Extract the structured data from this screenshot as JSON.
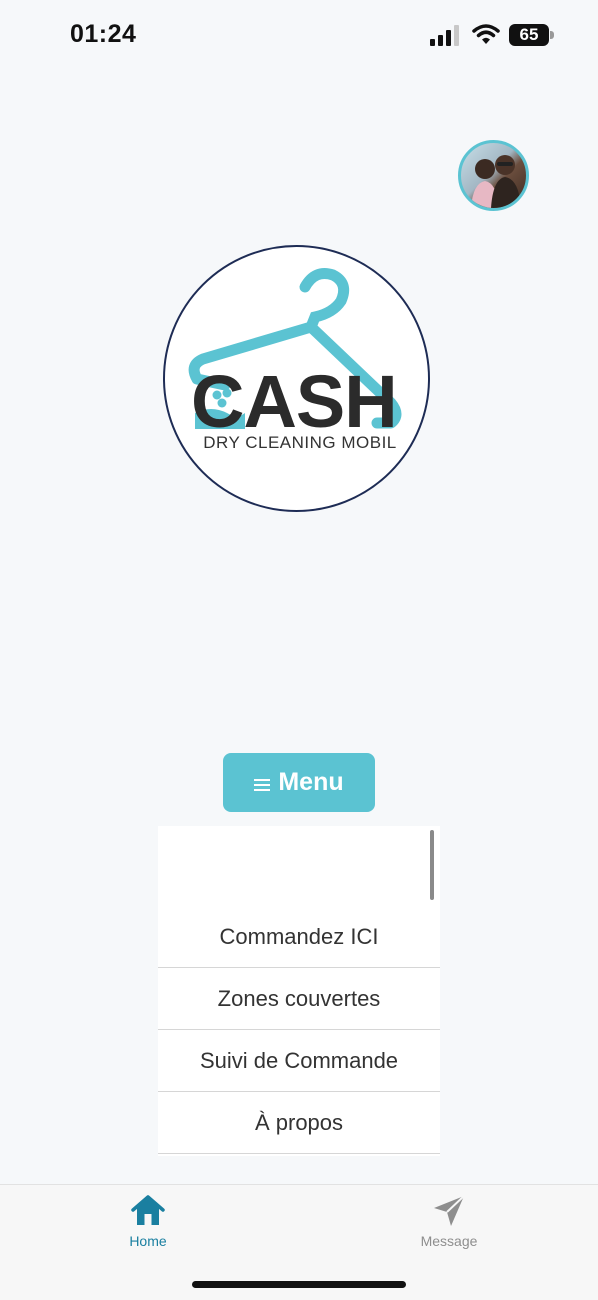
{
  "status_bar": {
    "time": "01:24",
    "battery": "65",
    "icons": [
      "signal-icon",
      "wifi-icon",
      "battery-icon"
    ]
  },
  "avatar": {
    "icon": "profile-photo"
  },
  "logo": {
    "title": "CASH",
    "subtitle": "DRY CLEANING MOBIL",
    "colors": {
      "accent": "#5bc3d2",
      "text": "#2b2b2b",
      "ring": "#1e2c55"
    }
  },
  "menu_button": {
    "label": "Menu",
    "icon": "hamburger-icon"
  },
  "menu": {
    "items": [
      {
        "label": "Commandez ICI"
      },
      {
        "label": "Zones couvertes"
      },
      {
        "label": "Suivi de Commande"
      },
      {
        "label": "À propos"
      }
    ]
  },
  "tab_bar": {
    "tabs": [
      {
        "label": "Home",
        "icon": "home-icon",
        "active": true
      },
      {
        "label": "Message",
        "icon": "send-icon",
        "active": false
      }
    ],
    "active_color": "#1a7fa0",
    "inactive_color": "#8e8e8e"
  }
}
